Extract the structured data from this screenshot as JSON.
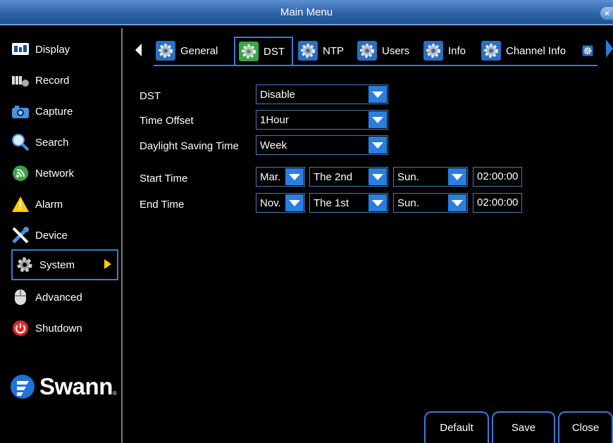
{
  "window": {
    "title": "Main Menu",
    "close_glyph": "×"
  },
  "sidebar": {
    "items": [
      {
        "label": "Display",
        "icon": "display-icon"
      },
      {
        "label": "Record",
        "icon": "record-icon"
      },
      {
        "label": "Capture",
        "icon": "camera-icon"
      },
      {
        "label": "Search",
        "icon": "search-icon"
      },
      {
        "label": "Network",
        "icon": "network-icon"
      },
      {
        "label": "Alarm",
        "icon": "alarm-icon"
      },
      {
        "label": "Device",
        "icon": "device-icon"
      },
      {
        "label": "System",
        "icon": "gear-icon",
        "active": true
      },
      {
        "label": "Advanced",
        "icon": "mouse-icon"
      },
      {
        "label": "Shutdown",
        "icon": "power-icon"
      }
    ],
    "logo": "Swann"
  },
  "tabs": [
    "General",
    "DST",
    "NTP",
    "Users",
    "Info",
    "Channel Info"
  ],
  "active_tab": "DST",
  "form": {
    "dst": {
      "label": "DST",
      "value": "Disable"
    },
    "time_offset": {
      "label": "Time Offset",
      "value": "1Hour"
    },
    "dst_mode": {
      "label": "Daylight Saving Time",
      "value": "Week"
    },
    "start": {
      "label": "Start Time",
      "month": "Mar.",
      "week": "The 2nd",
      "day": "Sun.",
      "time": "02:00:00"
    },
    "end": {
      "label": "End Time",
      "month": "Nov.",
      "week": "The 1st",
      "day": "Sun.",
      "time": "02:00:00"
    }
  },
  "buttons": {
    "default": "Default",
    "save": "Save",
    "close": "Close"
  },
  "colors": {
    "accent": "#2a7ee0",
    "title_bar": "#3a70b8",
    "arrow": "#ffcc00"
  }
}
